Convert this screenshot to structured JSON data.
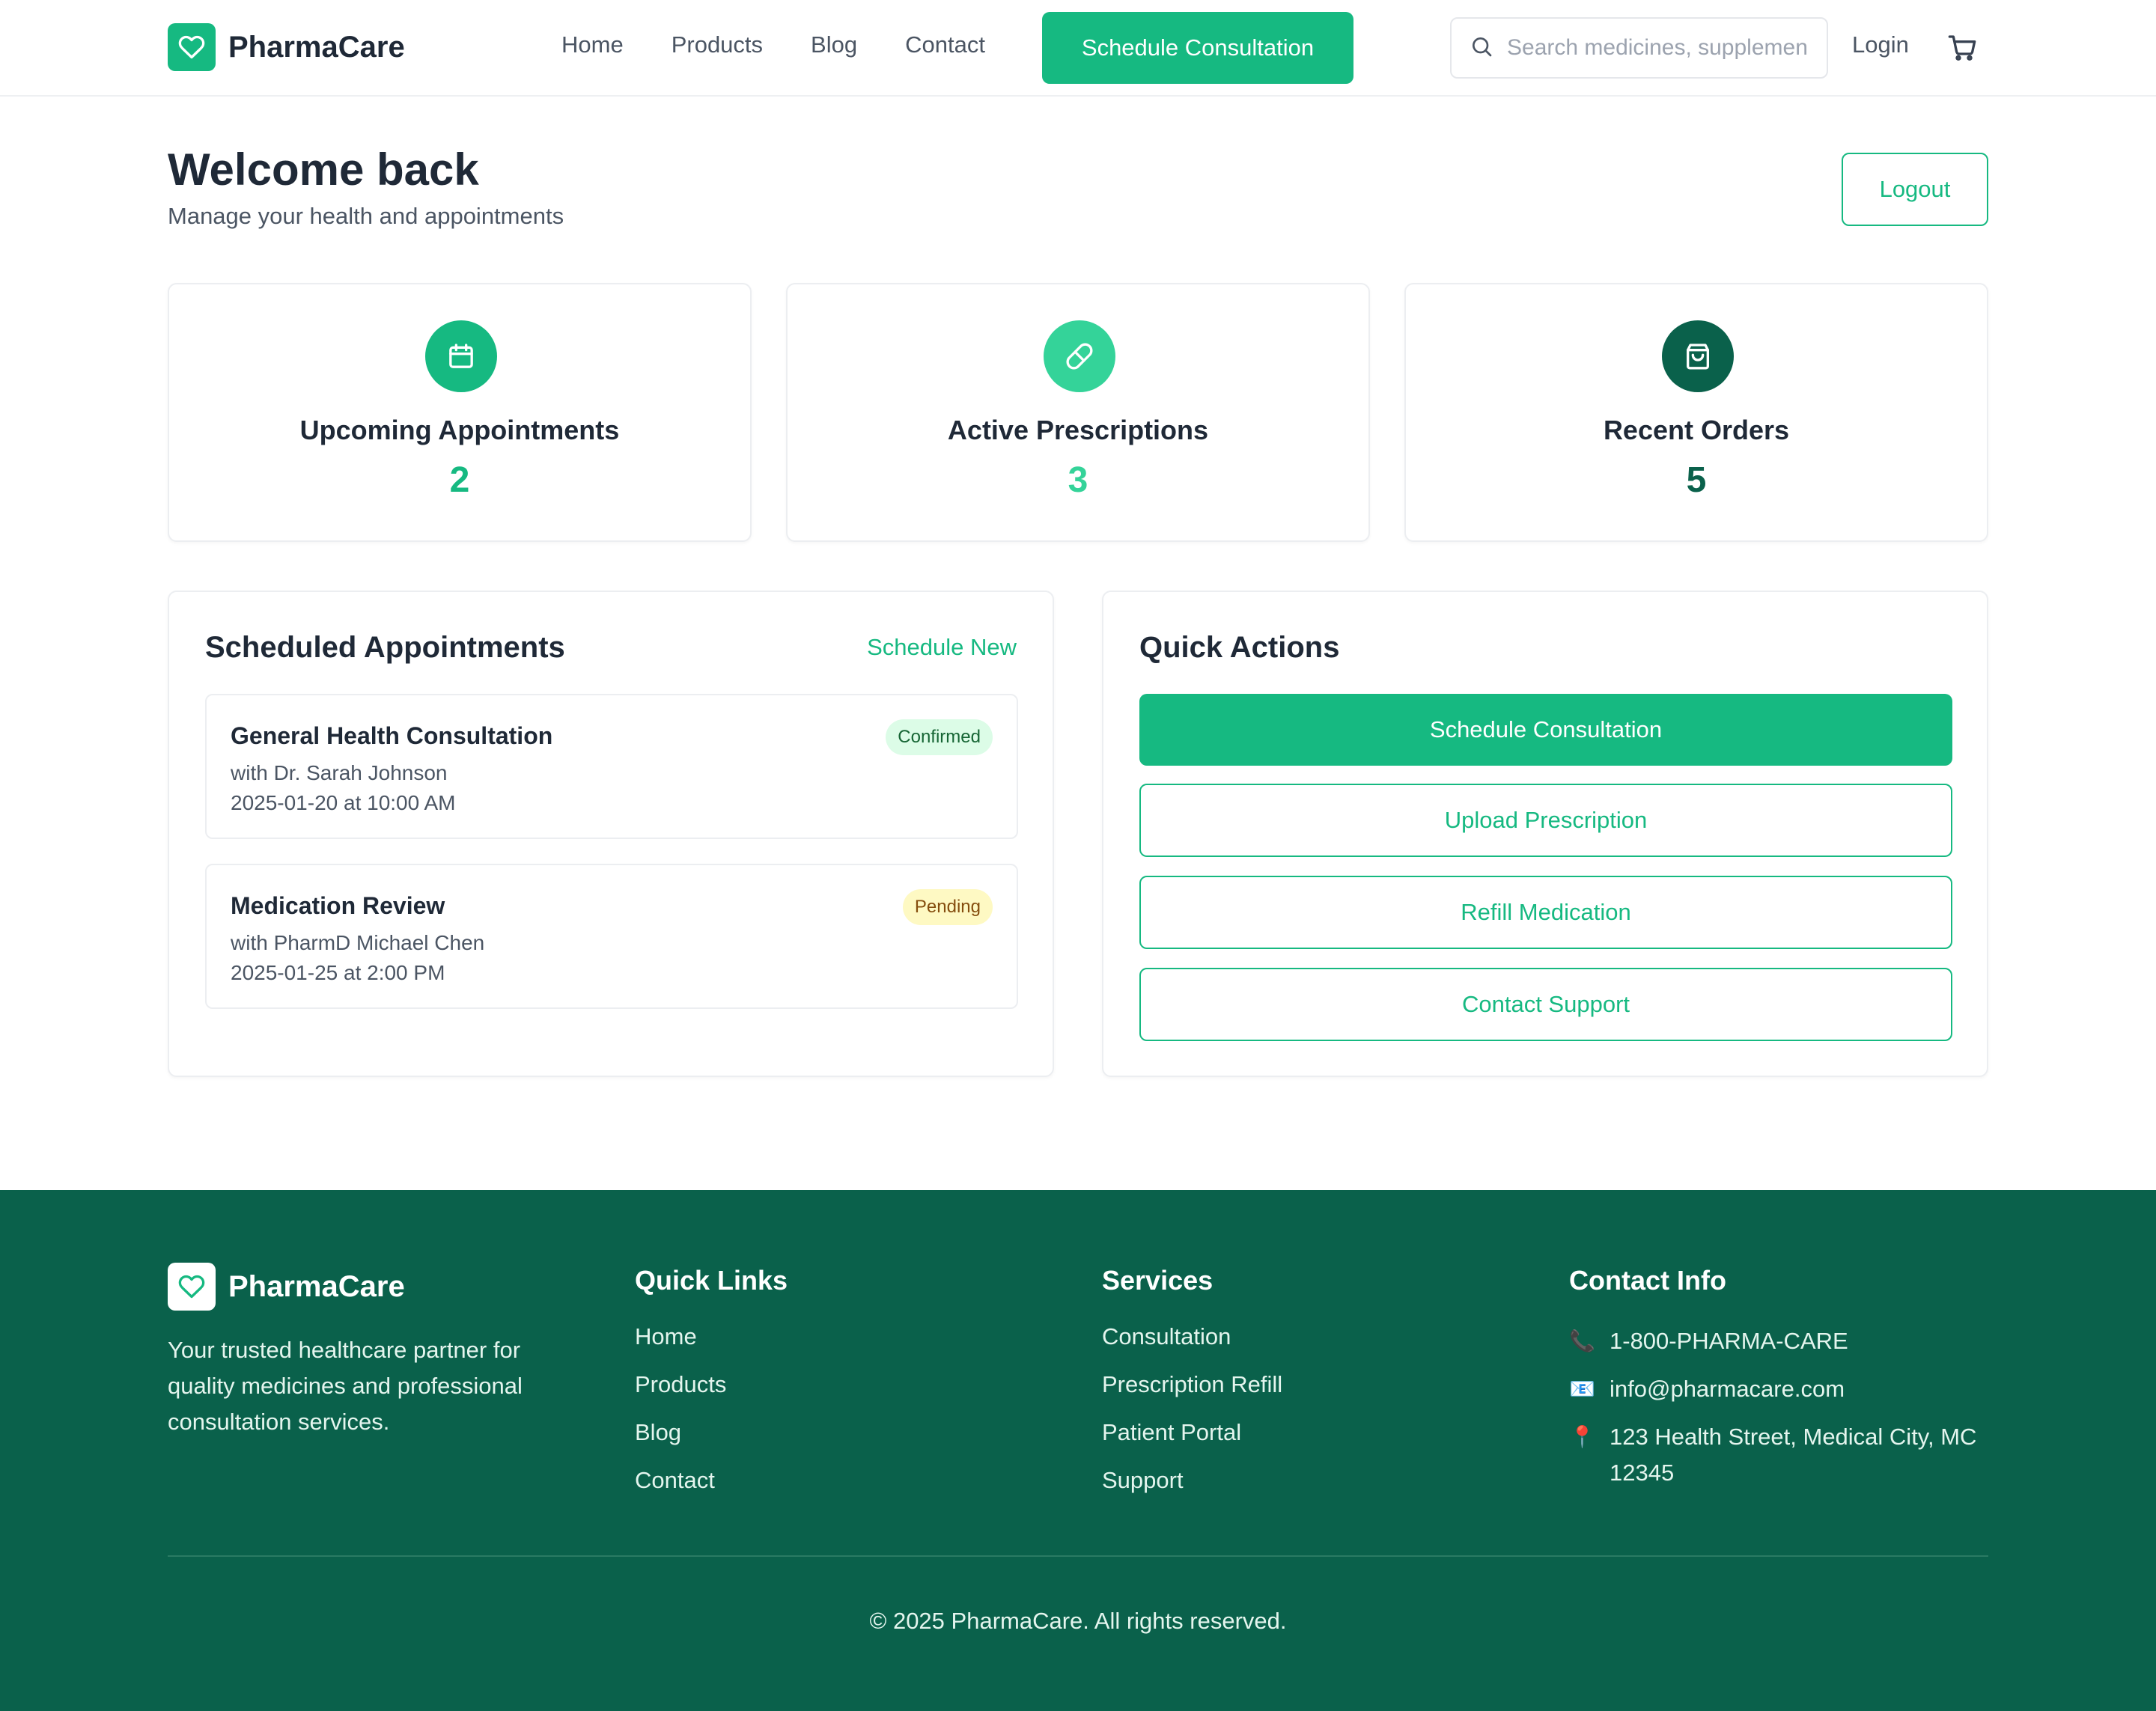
{
  "brand": {
    "name": "PharmaCare"
  },
  "nav": {
    "items": [
      "Home",
      "Products",
      "Blog",
      "Contact"
    ]
  },
  "header": {
    "cta_label": "Schedule Consultation",
    "search_placeholder": "Search medicines, supplements...",
    "login_label": "Login"
  },
  "welcome": {
    "title": "Welcome back",
    "subtitle": "Manage your health and appointments",
    "logout_label": "Logout"
  },
  "stats": [
    {
      "label": "Upcoming Appointments",
      "value": "2",
      "icon": "calendar-icon",
      "color": "#16b981"
    },
    {
      "label": "Active Prescriptions",
      "value": "3",
      "icon": "pill-icon",
      "color": "#34d399"
    },
    {
      "label": "Recent Orders",
      "value": "5",
      "icon": "shopping-bag-icon",
      "color": "#0a614b"
    }
  ],
  "appointments": {
    "title": "Scheduled Appointments",
    "schedule_new_label": "Schedule New",
    "items": [
      {
        "title": "General Health Consultation",
        "doctor": "with Dr. Sarah Johnson",
        "datetime": "2025-01-20 at 10:00 AM",
        "status": "Confirmed"
      },
      {
        "title": "Medication Review",
        "doctor": "with PharmD Michael Chen",
        "datetime": "2025-01-25 at 2:00 PM",
        "status": "Pending"
      }
    ]
  },
  "quick_actions": {
    "title": "Quick Actions",
    "items": [
      "Schedule Consultation",
      "Upload Prescription",
      "Refill Medication",
      "Contact Support"
    ]
  },
  "footer": {
    "brand_name": "PharmaCare",
    "description": "Your trusted healthcare partner for quality medicines and professional consultation services.",
    "quick_links": {
      "title": "Quick Links",
      "items": [
        "Home",
        "Products",
        "Blog",
        "Contact"
      ]
    },
    "services": {
      "title": "Services",
      "items": [
        "Consultation",
        "Prescription Refill",
        "Patient Portal",
        "Support"
      ]
    },
    "contact": {
      "title": "Contact Info",
      "phone": "1-800-PHARMA-CARE",
      "email": "info@pharmacare.com",
      "address": "123 Health Street, Medical City, MC 12345"
    },
    "copyright": "© 2025 PharmaCare. All rights reserved."
  },
  "colors": {
    "accent": "#16b981",
    "footer_bg": "#0a614b",
    "confirmed_bg": "#dcfce7",
    "confirmed_text": "#166534",
    "pending_bg": "#fef9c3",
    "pending_text": "#854d0e"
  }
}
